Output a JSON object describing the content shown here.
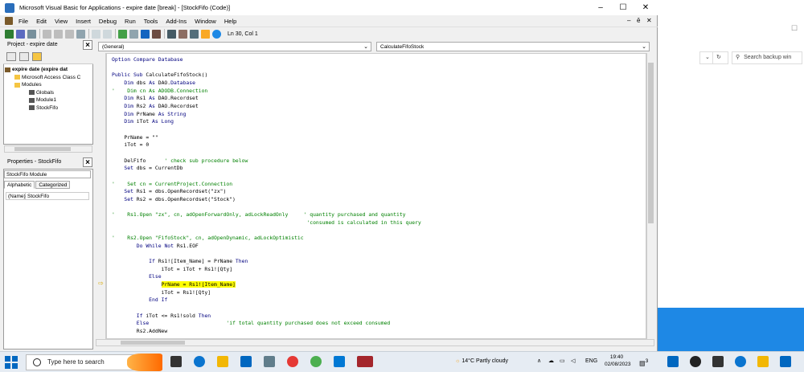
{
  "vba": {
    "title": "Microsoft Visual Basic for Applications - expire date [break] - [StockFifo (Code)]",
    "window_controls": [
      "–",
      "☐",
      "✕"
    ],
    "menu": [
      "File",
      "Edit",
      "View",
      "Insert",
      "Debug",
      "Run",
      "Tools",
      "Add-Ins",
      "Window",
      "Help"
    ],
    "mdi_controls": [
      "–",
      "ē",
      "✕"
    ],
    "status_position": "Ln 30, Col 1"
  },
  "project": {
    "title": "Project - expire date",
    "tree": [
      "expire date (expire dat",
      "Microsoft Access Class C",
      "Modules",
      "Globals",
      "Module1",
      "StockFifo"
    ]
  },
  "properties": {
    "title": "Properties - StockFifo",
    "object": "StockFifo Module",
    "tabs": [
      "Alphabetic",
      "Categorized"
    ],
    "row_key": "(Name)",
    "row_value": "StockFifo"
  },
  "code": {
    "object_combo": "(General)",
    "proc_combo": "CalculateFifoStock",
    "lines": [
      "Option Compare Database",
      "",
      "Public Sub CalculateFifoStock()",
      "    Dim dbs As DAO.Database",
      "'    Dim cn As ADODB.Connection",
      "    Dim Rs1 As DAO.Recordset",
      "    Dim Rs2 As DAO.Recordset",
      "    Dim PrName As String",
      "    Dim iTot As Long",
      "",
      "    PrName = \"\"",
      "    iTot = 0",
      "",
      "    DelFifo      ' check sub procedure below",
      "    Set dbs = CurrentDb",
      "",
      "'    Set cn = CurrentProject.Connection",
      "    Set Rs1 = dbs.OpenRecordset(\"zx\")",
      "    Set Rs2 = dbs.OpenRecordset(\"Stock\")",
      "",
      "'    Rs1.Open \"zx\", cn, adOpenForwardOnly, adLockReadOnly     ' quantity purchased and quantity",
      "                                                               'consumed is calculated in this query",
      "",
      "'    Rs2.Open \"FifoStock\", cn, adOpenDynamic, adLockOptimistic",
      "        Do While Not Rs1.EOF",
      "",
      "            If Rs1![Item_Name] = PrName Then",
      "                iTot = iTot + Rs1![Qty]",
      "            Else",
      "                PrName = Rs1![Item_Name]",
      "                iTot = Rs1![Qty]",
      "            End If",
      "",
      "        If iTot <= Rs1!sold Then",
      "        Else                         'if total quantity purchased does not exceed consumed",
      "        Rs2.AddNew"
    ]
  },
  "browser": {
    "search_placeholder": "Search backup win",
    "window_control": "☐"
  },
  "taskbar": {
    "search_placeholder": "Type here to search",
    "weather": "14°C  Partly cloudy",
    "language": "ENG",
    "time": "19:40",
    "date": "02/08/2023",
    "notification_count": "3"
  }
}
